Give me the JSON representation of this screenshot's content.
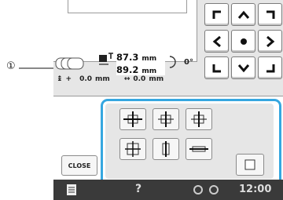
{
  "callout": {
    "number": "①"
  },
  "size_display": {
    "width_value": "87.3",
    "width_unit": "mm",
    "height_value": "89.2",
    "height_unit": "mm"
  },
  "rotation": {
    "degree": "0°",
    "offset_x": "0.0",
    "offset_x_unit": "mm",
    "offset_y": "0.0",
    "offset_y_unit": "mm"
  },
  "buttons": {
    "close_label": "CLOSE"
  },
  "status_bar": {
    "time": "12:00",
    "help": "?"
  },
  "icons": {
    "arrows": [
      "arrow-top-left-icon",
      "arrow-up-icon",
      "arrow-top-right-icon",
      "arrow-left-icon",
      "center-dot-icon",
      "arrow-right-icon",
      "arrow-bottom-left-icon",
      "arrow-down-icon",
      "arrow-bottom-right-icon"
    ],
    "align": [
      "align-center-both-icon",
      "align-center-horizontal-icon",
      "align-right-edge-icon",
      "align-frame-corners-icon",
      "align-vertical-icon",
      "align-horizontal-icon",
      "blank-square-icon"
    ]
  },
  "colors": {
    "highlight": "#36a7e0",
    "bar": "#3a3a3a"
  }
}
